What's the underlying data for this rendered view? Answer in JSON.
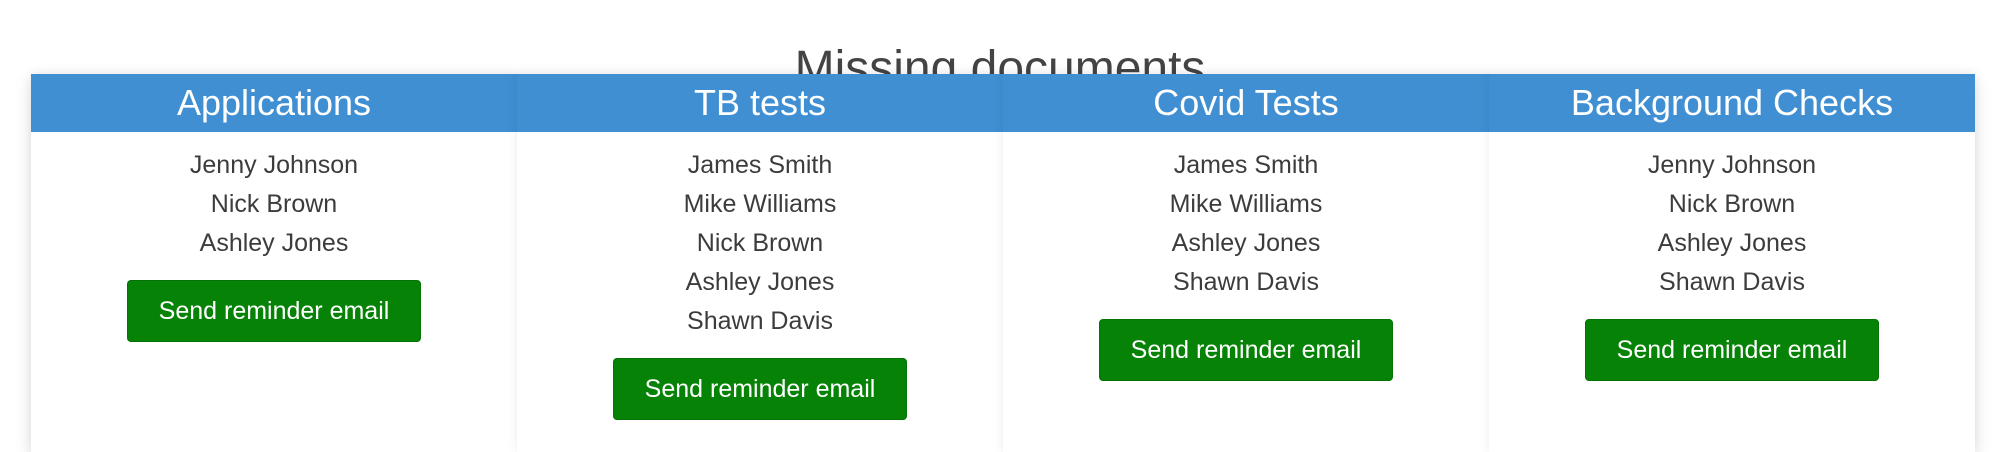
{
  "page_title": "Missing documents",
  "colors": {
    "header_blue": "#3f8fd2",
    "button_green": "#068206"
  },
  "columns": [
    {
      "title": "Applications",
      "names": [
        "Jenny Johnson",
        "Nick Brown",
        "Ashley Jones"
      ],
      "button_label": "Send reminder email"
    },
    {
      "title": "TB tests",
      "names": [
        "James Smith",
        "Mike Williams",
        "Nick Brown",
        "Ashley Jones",
        "Shawn Davis"
      ],
      "button_label": "Send reminder email"
    },
    {
      "title": "Covid Tests",
      "names": [
        "James Smith",
        "Mike Williams",
        "Ashley Jones",
        "Shawn Davis"
      ],
      "button_label": "Send reminder email"
    },
    {
      "title": "Background Checks",
      "names": [
        "Jenny Johnson",
        "Nick Brown",
        "Ashley Jones",
        "Shawn Davis"
      ],
      "button_label": "Send reminder email"
    }
  ]
}
